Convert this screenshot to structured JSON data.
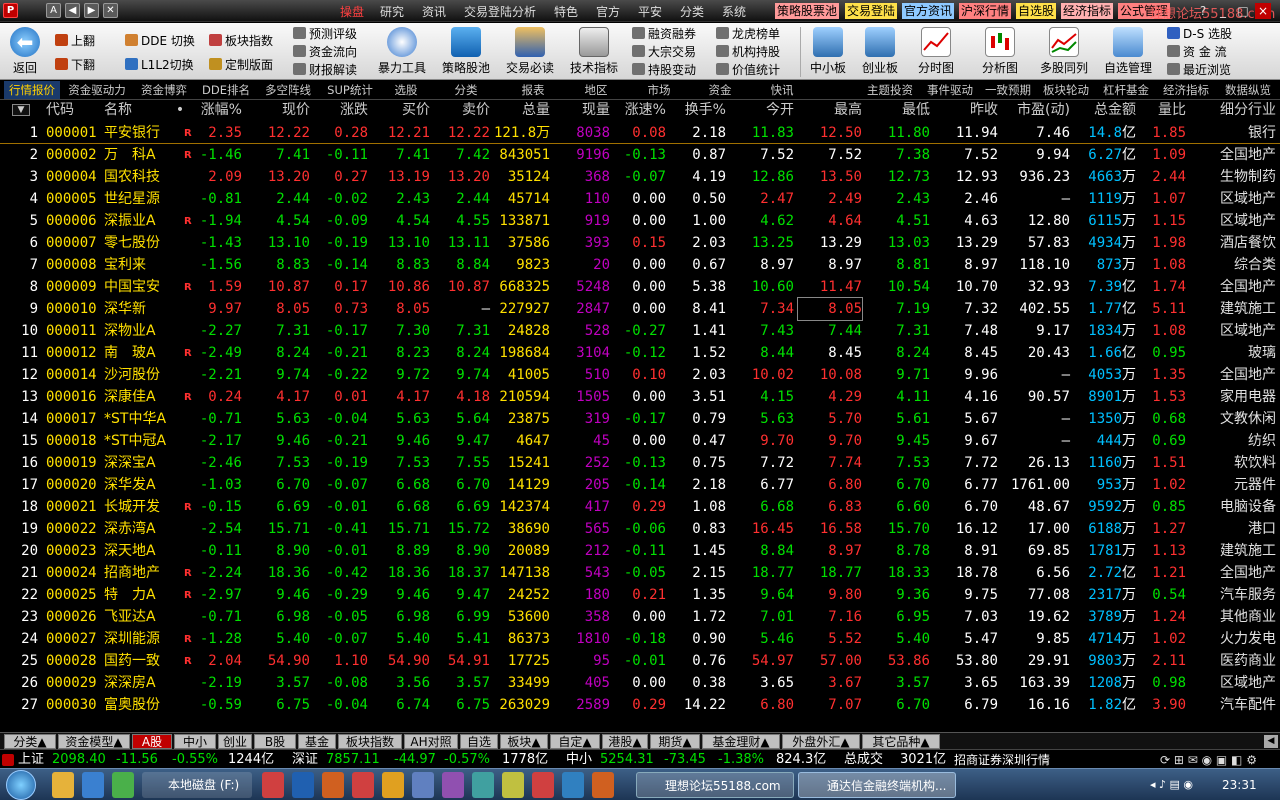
{
  "window": {
    "logo": "P",
    "min": "–",
    "max": "□",
    "close": "×"
  },
  "top_left_icons": [
    "A",
    "◀",
    "▶",
    "✕"
  ],
  "menu": [
    "操盘",
    "研究",
    "资讯",
    "交易登陆分析",
    "特色",
    "官方",
    "平安",
    "分类",
    "系统"
  ],
  "quick_links": [
    {
      "label": "策略股票池",
      "bg": "#ff9a9a"
    },
    {
      "label": "交易登陆",
      "bg": "#ffe04a"
    },
    {
      "label": "官方资讯",
      "bg": "#8ec9ff"
    },
    {
      "label": "沪深行情",
      "bg": "#ff8080"
    },
    {
      "label": "自选股",
      "bg": "#ffe04a"
    },
    {
      "label": "经济指标",
      "bg": "#ffb0b0"
    },
    {
      "label": "公式管理",
      "bg": "#ff8080"
    }
  ],
  "watermark": "理想论坛55188.com",
  "window_controls": [
    "?",
    "_",
    "□",
    "×"
  ],
  "toolbar": {
    "back": "返回",
    "small_groups": [
      [
        "上翻",
        "下翻"
      ],
      [
        "DDE 切换",
        "L1L2切换"
      ],
      [
        "板块指数",
        "定制版面"
      ],
      [
        "预测评级",
        "资金流向",
        "财报解读"
      ]
    ],
    "big_buttons": [
      "暴力工具",
      "策略股池",
      "交易必读",
      "技术指标"
    ],
    "small_groups2": [
      [
        "融资融券",
        "大宗交易",
        "持股变动"
      ],
      [
        "龙虎榜单",
        "机构持股",
        "价值统计"
      ]
    ],
    "big_buttons2": [
      "中小板",
      "创业板",
      "分时图",
      "分析图",
      "多股同列",
      "自选管理"
    ],
    "right_links": [
      "D-S 选股",
      "资 金 流",
      "最近浏览"
    ]
  },
  "tabs": [
    {
      "label": "行情报价",
      "active": true
    },
    {
      "label": "资金驱动力"
    },
    {
      "label": "资金博弈"
    },
    {
      "label": "DDE排名"
    },
    {
      "label": "多空阵线"
    },
    {
      "label": "SUP统计"
    },
    {
      "label": "选股"
    },
    {
      "label": "分类"
    },
    {
      "label": "报表"
    },
    {
      "label": "地区"
    },
    {
      "label": "市场"
    },
    {
      "label": "资金"
    },
    {
      "label": "快讯"
    },
    {
      "label": ""
    },
    {
      "label": "主题投资"
    },
    {
      "label": "事件驱动"
    },
    {
      "label": "一致预期"
    },
    {
      "label": "板块轮动"
    },
    {
      "label": "杠杆基金"
    },
    {
      "label": "经济指标"
    },
    {
      "label": "数据纵览"
    }
  ],
  "columns": [
    "代码",
    "名称",
    "•",
    "涨幅%",
    "现价",
    "涨跌",
    "买价",
    "卖价",
    "总量",
    "现量",
    "涨速%",
    "换手%",
    "今开",
    "最高",
    "最低",
    "昨收",
    "市盈(动)",
    "总金额",
    "量比",
    "细分行业"
  ],
  "rows": [
    [
      "1",
      "000001",
      "平安银行",
      "R",
      "2.35",
      "12.22",
      "0.28",
      "12.21",
      "12.22",
      "121.8万",
      "8038",
      "0.08",
      "2.18",
      "11.83",
      "12.50",
      "11.80",
      "11.94",
      "7.46",
      "14.8",
      "亿",
      "1.85",
      "银行"
    ],
    [
      "2",
      "000002",
      "万　科A",
      "R",
      "-1.46",
      "7.41",
      "-0.11",
      "7.41",
      "7.42",
      "843051",
      "9196",
      "-0.13",
      "0.87",
      "7.52",
      "7.52",
      "7.38",
      "7.52",
      "9.94",
      "6.27",
      "亿",
      "1.09",
      "全国地产"
    ],
    [
      "3",
      "000004",
      "国农科技",
      "",
      "2.09",
      "13.20",
      "0.27",
      "13.19",
      "13.20",
      "35124",
      "368",
      "-0.07",
      "4.19",
      "12.86",
      "13.50",
      "12.73",
      "12.93",
      "936.23",
      "4663",
      "万",
      "2.44",
      "生物制药"
    ],
    [
      "4",
      "000005",
      "世纪星源",
      "",
      "-0.81",
      "2.44",
      "-0.02",
      "2.43",
      "2.44",
      "45714",
      "110",
      "0.00",
      "0.50",
      "2.47",
      "2.49",
      "2.43",
      "2.46",
      "–",
      "1119",
      "万",
      "1.07",
      "区域地产"
    ],
    [
      "5",
      "000006",
      "深振业A",
      "R",
      "-1.94",
      "4.54",
      "-0.09",
      "4.54",
      "4.55",
      "133871",
      "919",
      "0.00",
      "1.00",
      "4.62",
      "4.64",
      "4.51",
      "4.63",
      "12.80",
      "6115",
      "万",
      "1.15",
      "区域地产"
    ],
    [
      "6",
      "000007",
      "零七股份",
      "",
      "-1.43",
      "13.10",
      "-0.19",
      "13.10",
      "13.11",
      "37586",
      "393",
      "0.15",
      "2.03",
      "13.25",
      "13.29",
      "13.03",
      "13.29",
      "57.83",
      "4934",
      "万",
      "1.98",
      "酒店餐饮"
    ],
    [
      "7",
      "000008",
      "宝利来",
      "",
      "-1.56",
      "8.83",
      "-0.14",
      "8.83",
      "8.84",
      "9823",
      "20",
      "0.00",
      "0.67",
      "8.97",
      "8.97",
      "8.81",
      "8.97",
      "118.10",
      "873",
      "万",
      "1.08",
      "综合类"
    ],
    [
      "8",
      "000009",
      "中国宝安",
      "R",
      "1.59",
      "10.87",
      "0.17",
      "10.86",
      "10.87",
      "668325",
      "5248",
      "0.00",
      "5.38",
      "10.60",
      "11.47",
      "10.54",
      "10.70",
      "32.93",
      "7.39",
      "亿",
      "1.74",
      "全国地产"
    ],
    [
      "9",
      "000010",
      "深华新",
      "",
      "9.97",
      "8.05",
      "0.73",
      "8.05",
      "–",
      "227927",
      "2847",
      "0.00",
      "8.41",
      "7.34",
      "8.05",
      "7.19",
      "7.32",
      "402.55",
      "1.77",
      "亿",
      "5.11",
      "建筑施工"
    ],
    [
      "10",
      "000011",
      "深物业A",
      "",
      "-2.27",
      "7.31",
      "-0.17",
      "7.30",
      "7.31",
      "24828",
      "528",
      "-0.27",
      "1.41",
      "7.43",
      "7.44",
      "7.31",
      "7.48",
      "9.17",
      "1834",
      "万",
      "1.08",
      "区域地产"
    ],
    [
      "11",
      "000012",
      "南　玻A",
      "R",
      "-2.49",
      "8.24",
      "-0.21",
      "8.23",
      "8.24",
      "198684",
      "3104",
      "-0.12",
      "1.52",
      "8.44",
      "8.45",
      "8.24",
      "8.45",
      "20.43",
      "1.66",
      "亿",
      "0.95",
      "玻璃"
    ],
    [
      "12",
      "000014",
      "沙河股份",
      "",
      "-2.21",
      "9.74",
      "-0.22",
      "9.72",
      "9.74",
      "41005",
      "510",
      "0.10",
      "2.03",
      "10.02",
      "10.08",
      "9.71",
      "9.96",
      "–",
      "4053",
      "万",
      "1.35",
      "全国地产"
    ],
    [
      "13",
      "000016",
      "深康佳A",
      "R",
      "0.24",
      "4.17",
      "0.01",
      "4.17",
      "4.18",
      "210594",
      "1505",
      "0.00",
      "3.51",
      "4.15",
      "4.29",
      "4.11",
      "4.16",
      "90.57",
      "8901",
      "万",
      "1.53",
      "家用电器"
    ],
    [
      "14",
      "000017",
      "*ST中华A",
      "",
      "-0.71",
      "5.63",
      "-0.04",
      "5.63",
      "5.64",
      "23875",
      "319",
      "-0.17",
      "0.79",
      "5.63",
      "5.70",
      "5.61",
      "5.67",
      "–",
      "1350",
      "万",
      "0.68",
      "文教休闲"
    ],
    [
      "15",
      "000018",
      "*ST中冠A",
      "",
      "-2.17",
      "9.46",
      "-0.21",
      "9.46",
      "9.47",
      "4647",
      "45",
      "0.00",
      "0.47",
      "9.70",
      "9.70",
      "9.45",
      "9.67",
      "–",
      "444",
      "万",
      "0.69",
      "纺织"
    ],
    [
      "16",
      "000019",
      "深深宝A",
      "",
      "-2.46",
      "7.53",
      "-0.19",
      "7.53",
      "7.55",
      "15241",
      "252",
      "-0.13",
      "0.75",
      "7.72",
      "7.74",
      "7.53",
      "7.72",
      "26.13",
      "1160",
      "万",
      "1.51",
      "软饮料"
    ],
    [
      "17",
      "000020",
      "深华发A",
      "",
      "-1.03",
      "6.70",
      "-0.07",
      "6.68",
      "6.70",
      "14129",
      "205",
      "-0.14",
      "2.18",
      "6.77",
      "6.80",
      "6.70",
      "6.77",
      "1761.00",
      "953",
      "万",
      "1.02",
      "元器件"
    ],
    [
      "18",
      "000021",
      "长城开发",
      "R",
      "-0.15",
      "6.69",
      "-0.01",
      "6.68",
      "6.69",
      "142374",
      "417",
      "0.29",
      "1.08",
      "6.68",
      "6.83",
      "6.60",
      "6.70",
      "48.67",
      "9592",
      "万",
      "0.85",
      "电脑设备"
    ],
    [
      "19",
      "000022",
      "深赤湾A",
      "",
      "-2.54",
      "15.71",
      "-0.41",
      "15.71",
      "15.72",
      "38690",
      "565",
      "-0.06",
      "0.83",
      "16.45",
      "16.58",
      "15.70",
      "16.12",
      "17.00",
      "6188",
      "万",
      "1.27",
      "港口"
    ],
    [
      "20",
      "000023",
      "深天地A",
      "",
      "-0.11",
      "8.90",
      "-0.01",
      "8.89",
      "8.90",
      "20089",
      "212",
      "-0.11",
      "1.45",
      "8.84",
      "8.97",
      "8.78",
      "8.91",
      "69.85",
      "1781",
      "万",
      "1.13",
      "建筑施工"
    ],
    [
      "21",
      "000024",
      "招商地产",
      "R",
      "-2.24",
      "18.36",
      "-0.42",
      "18.36",
      "18.37",
      "147138",
      "543",
      "-0.05",
      "2.15",
      "18.77",
      "18.77",
      "18.33",
      "18.78",
      "6.56",
      "2.72",
      "亿",
      "1.21",
      "全国地产"
    ],
    [
      "22",
      "000025",
      "特　力A",
      "R",
      "-2.97",
      "9.46",
      "-0.29",
      "9.46",
      "9.47",
      "24252",
      "180",
      "0.21",
      "1.35",
      "9.64",
      "9.80",
      "9.36",
      "9.75",
      "77.08",
      "2317",
      "万",
      "0.54",
      "汽车服务"
    ],
    [
      "23",
      "000026",
      "飞亚达A",
      "",
      "-0.71",
      "6.98",
      "-0.05",
      "6.98",
      "6.99",
      "53600",
      "358",
      "0.00",
      "1.72",
      "7.01",
      "7.16",
      "6.95",
      "7.03",
      "19.62",
      "3789",
      "万",
      "1.24",
      "其他商业"
    ],
    [
      "24",
      "000027",
      "深圳能源",
      "R",
      "-1.28",
      "5.40",
      "-0.07",
      "5.40",
      "5.41",
      "86373",
      "1810",
      "-0.18",
      "0.90",
      "5.46",
      "5.52",
      "5.40",
      "5.47",
      "9.85",
      "4714",
      "万",
      "1.02",
      "火力发电"
    ],
    [
      "25",
      "000028",
      "国药一致",
      "R",
      "2.04",
      "54.90",
      "1.10",
      "54.90",
      "54.91",
      "17725",
      "95",
      "-0.01",
      "0.76",
      "54.97",
      "57.00",
      "53.86",
      "53.80",
      "29.91",
      "9803",
      "万",
      "2.11",
      "医药商业"
    ],
    [
      "26",
      "000029",
      "深深房A",
      "",
      "-2.19",
      "3.57",
      "-0.08",
      "3.56",
      "3.57",
      "33499",
      "405",
      "0.00",
      "0.38",
      "3.65",
      "3.67",
      "3.57",
      "3.65",
      "163.39",
      "1208",
      "万",
      "0.98",
      "区域地产"
    ],
    [
      "27",
      "000030",
      "富奥股份",
      "",
      "-0.59",
      "6.75",
      "-0.04",
      "6.74",
      "6.75",
      "263029",
      "2589",
      "0.29",
      "14.22",
      "6.80",
      "7.07",
      "6.70",
      "6.79",
      "16.16",
      "1.82",
      "亿",
      "3.90",
      "汽车配件"
    ]
  ],
  "bottom_tabs": [
    {
      "label": "分类▲"
    },
    {
      "label": "资金模型▲"
    },
    {
      "label": "A股",
      "active": true
    },
    {
      "label": "中小"
    },
    {
      "label": "创业"
    },
    {
      "label": "B股"
    },
    {
      "label": "基金"
    },
    {
      "label": "板块指数"
    },
    {
      "label": "AH对照"
    },
    {
      "label": "自选"
    },
    {
      "label": "板块▲"
    },
    {
      "label": "自定▲"
    },
    {
      "label": "港股▲"
    },
    {
      "label": "期货▲"
    },
    {
      "label": "基金理财▲"
    },
    {
      "label": "外盘外汇▲"
    },
    {
      "label": "其它品种▲"
    }
  ],
  "status": {
    "sh_label": "上证",
    "sh_val": "2098.40",
    "sh_chg": "-11.56",
    "sh_pct": "-0.55%",
    "sh_amt": "1244亿",
    "sz_label": "深证",
    "sz_val": "7857.11",
    "sz_chg": "-44.97",
    "sz_pct": "-0.57%",
    "sz_amt": "1778亿",
    "zx_label": "中小",
    "zx_val": "5254.31",
    "zx_chg": "-73.45",
    "zx_pct": "-1.38%",
    "zx_amt": "824.3亿",
    "total_label": "总成交",
    "total_amt": "3021亿",
    "broker": "招商证券深圳行情"
  },
  "taskbar": {
    "items": [
      "本地磁盘 (F:)",
      "理想论坛55188.com",
      "通达信金融终端机构..."
    ],
    "clock": "23:31"
  },
  "colors": {
    "up": "#ff3030",
    "down": "#00e000",
    "flat": "#ffffff",
    "code": "#ffe000",
    "name": "#ffe000",
    "accent": "#ffd000",
    "vol": "#ffe000",
    "nowvol": "#c000c0",
    "amt": "#00c0ff",
    "unit": "#ffffff",
    "industry": "#e0e0e0"
  }
}
